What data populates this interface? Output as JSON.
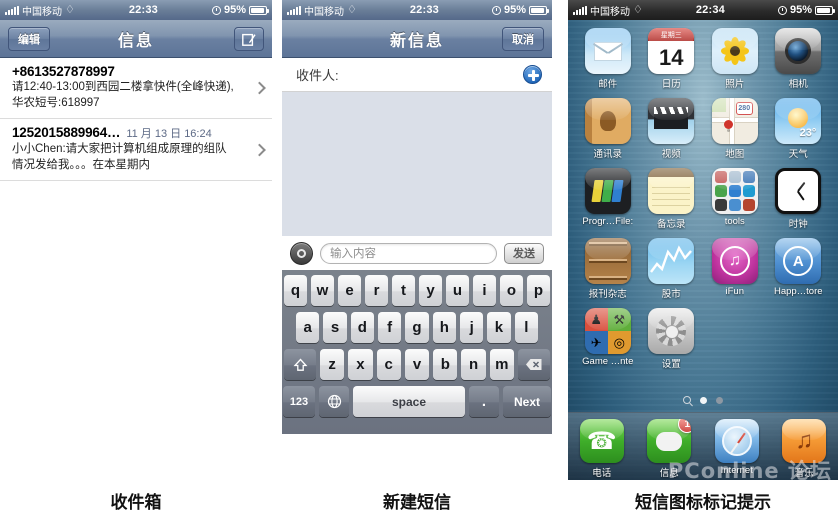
{
  "captions": {
    "panel1": "收件箱",
    "panel2": "新建短信",
    "panel3": "短信图标标记提示"
  },
  "watermark": "PConline 论坛",
  "panel1": {
    "status": {
      "carrier": "中国移动",
      "time": "22:33",
      "battery": "95%"
    },
    "nav": {
      "edit_label": "编辑",
      "title": "信息",
      "compose_icon": "compose-icon"
    },
    "messages": [
      {
        "from": "+8613527878997",
        "date": "",
        "preview": "请12:40-13:00到西园二楼拿快件(全峰快递),华农短号:618997"
      },
      {
        "from": "1252015889964…",
        "date": "11 月 13 日 16:24",
        "preview": "小小Chen:请大家把计算机组成原理的组队情况发给我。。。在本星期内"
      }
    ]
  },
  "panel2": {
    "status": {
      "carrier": "中国移动",
      "time": "22:33",
      "battery": "95%"
    },
    "nav": {
      "title": "新信息",
      "cancel_label": "取消"
    },
    "recipient": {
      "label": "收件人:",
      "add_icon": "plus-icon"
    },
    "toolbar": {
      "camera_icon": "camera-icon",
      "input_placeholder": "输入内容",
      "input_value": "",
      "send_label": "发送"
    },
    "keyboard": {
      "row1": [
        "q",
        "w",
        "e",
        "r",
        "t",
        "y",
        "u",
        "i",
        "o",
        "p"
      ],
      "row2": [
        "a",
        "s",
        "d",
        "f",
        "g",
        "h",
        "j",
        "k",
        "l"
      ],
      "row3": [
        "z",
        "x",
        "c",
        "v",
        "b",
        "n",
        "m"
      ],
      "shift_icon": "shift-icon",
      "backspace_icon": "backspace-icon",
      "num_label": "123",
      "globe_icon": "globe-icon",
      "space_label": "space",
      "period_label": ".",
      "return_label": "Next"
    }
  },
  "panel3": {
    "status": {
      "carrier": "中国移动",
      "time": "22:34",
      "battery": "95%"
    },
    "apps": [
      {
        "label": "邮件",
        "icon": "mail-icon"
      },
      {
        "label": "日历",
        "icon": "calendar-icon",
        "weekday": "星期三",
        "day": "14"
      },
      {
        "label": "照片",
        "icon": "photos-icon"
      },
      {
        "label": "相机",
        "icon": "camera-icon"
      },
      {
        "label": "通讯录",
        "icon": "contacts-icon"
      },
      {
        "label": "视频",
        "icon": "videos-icon"
      },
      {
        "label": "地图",
        "icon": "maps-icon",
        "shield": "280"
      },
      {
        "label": "天气",
        "icon": "weather-icon",
        "temp": "23°"
      },
      {
        "label": "Progr…File:",
        "icon": "files-icon"
      },
      {
        "label": "备忘录",
        "icon": "notes-icon"
      },
      {
        "label": "tools",
        "icon": "folder-tools-icon"
      },
      {
        "label": "时钟",
        "icon": "clock-icon"
      },
      {
        "label": "报刊杂志",
        "icon": "newsstand-icon"
      },
      {
        "label": "股市",
        "icon": "stocks-icon"
      },
      {
        "label": "iFun",
        "icon": "ifun-icon"
      },
      {
        "label": "Happ…tore",
        "icon": "appstore-icon"
      },
      {
        "label": "Game …nte",
        "icon": "gamecenter-icon"
      },
      {
        "label": "设置",
        "icon": "settings-icon"
      }
    ],
    "pages": {
      "count": 2,
      "active": 1,
      "search_icon": "search-icon"
    },
    "dock": [
      {
        "label": "电话",
        "icon": "phone-icon",
        "badge": ""
      },
      {
        "label": "信息",
        "icon": "messages-icon",
        "badge": "1"
      },
      {
        "label": "Internet",
        "icon": "safari-icon",
        "badge": ""
      },
      {
        "label": "音乐",
        "icon": "music-icon",
        "badge": ""
      }
    ]
  }
}
